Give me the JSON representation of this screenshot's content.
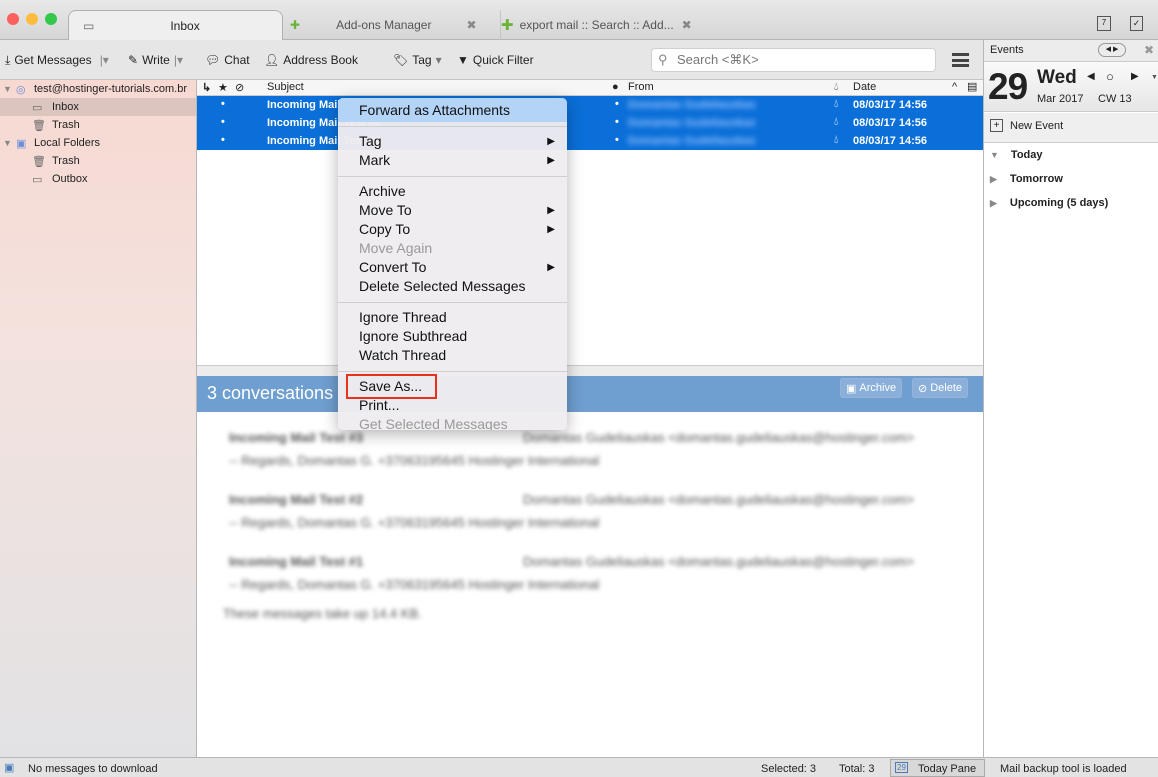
{
  "tabs": [
    {
      "label": "Inbox",
      "icon": "inbox-icon"
    },
    {
      "label": "Add-ons Manager",
      "icon": "puzzle-icon"
    },
    {
      "label": "export mail :: Search :: Add...",
      "icon": "puzzle-icon"
    }
  ],
  "toolbar": {
    "get_messages": "Get Messages",
    "write": "Write",
    "chat": "Chat",
    "address_book": "Address Book",
    "tag": "Tag",
    "quick_filter": "Quick Filter",
    "search_placeholder": "Search <⌘K>"
  },
  "folders": [
    {
      "label": "test@hostinger-tutorials.com.br"
    },
    {
      "label": "Inbox"
    },
    {
      "label": "Trash"
    },
    {
      "label": "Local Folders"
    },
    {
      "label": "Trash"
    },
    {
      "label": "Outbox"
    }
  ],
  "columns": {
    "subject": "Subject",
    "from": "From",
    "date": "Date"
  },
  "messages": [
    {
      "subject": "Incoming Mail Test #3",
      "from": "Domantas Gudeliauskas",
      "date": "08/03/17 14:56"
    },
    {
      "subject": "Incoming Mail Test #2",
      "from": "Domantas Gudeliauskas",
      "date": "08/03/17 14:56"
    },
    {
      "subject": "Incoming Mail Test #1",
      "from": "Domantas Gudeliauskas",
      "date": "08/03/17 14:56"
    }
  ],
  "context_menu": [
    {
      "label": "Forward as Attachments",
      "highlighted": true
    },
    {
      "label": "Tag",
      "submenu": true
    },
    {
      "label": "Mark",
      "submenu": true
    },
    {
      "label": "Archive"
    },
    {
      "label": "Move To",
      "submenu": true
    },
    {
      "label": "Copy To",
      "submenu": true
    },
    {
      "label": "Move Again",
      "disabled": true
    },
    {
      "label": "Convert To",
      "submenu": true
    },
    {
      "label": "Delete Selected Messages"
    },
    {
      "label": "Ignore Thread"
    },
    {
      "label": "Ignore Subthread"
    },
    {
      "label": "Watch Thread"
    },
    {
      "label": "Save As..."
    },
    {
      "label": "Print..."
    },
    {
      "label": "Get Selected Messages",
      "disabled": true
    }
  ],
  "conversation": {
    "title": "3 conversations",
    "archive": "Archive",
    "delete": "Delete",
    "items": [
      {
        "subject": "Incoming Mail Test #3",
        "from": "Domantas Gudeliauskas <domantas.gudeliauskas@hostinger.com>",
        "snippet": "-- Regards, Domantas G. +37063195645 Hostinger International"
      },
      {
        "subject": "Incoming Mail Test #2",
        "from": "Domantas Gudeliauskas <domantas.gudeliauskas@hostinger.com>",
        "snippet": "-- Regards, Domantas G. +37063195645 Hostinger International"
      },
      {
        "subject": "Incoming Mail Test #1",
        "from": "Domantas Gudeliauskas <domantas.gudeliauskas@hostinger.com>",
        "snippet": "-- Regards, Domantas G. +37063195645 Hostinger International"
      }
    ],
    "size_note": "These messages take up 14.4 KB."
  },
  "today_pane": {
    "title": "Events",
    "day": "29",
    "weekday": "Wed",
    "month": "Mar 2017",
    "week": "CW 13",
    "new_event": "New Event",
    "sections": [
      "Today",
      "Tomorrow",
      "Upcoming (5 days)"
    ]
  },
  "status": {
    "left": "No messages to download",
    "selected": "Selected: 3",
    "total": "Total: 3",
    "today_pane": "Today Pane",
    "today_icon_day": "29",
    "right": "Mail backup tool is loaded"
  },
  "colors": {
    "selection": "#0a6fd8",
    "conversation_header": "#6f9fd0",
    "highlight_box": "#e8321e"
  }
}
